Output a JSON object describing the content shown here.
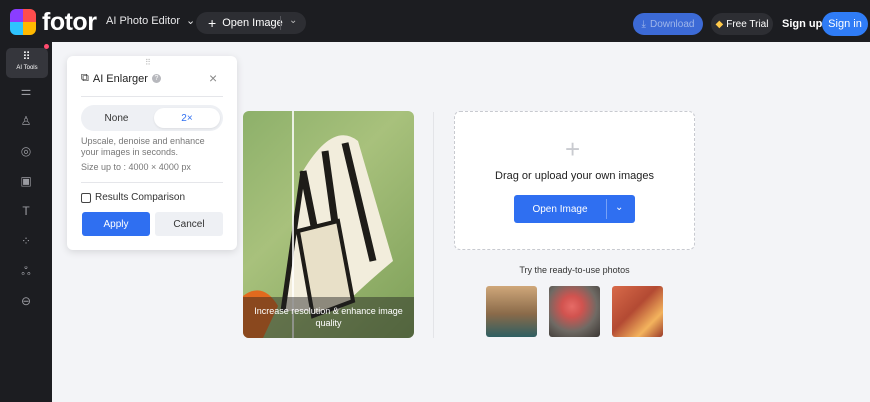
{
  "topbar": {
    "logo_text": "fotor",
    "editor_menu": "AI Photo Editor",
    "open_image": "Open Image",
    "download": "Download",
    "free_trial": "Free Trial",
    "sign_up": "Sign up",
    "sign_in": "Sign in"
  },
  "sidebar": {
    "ai_tools": "AI Tools",
    "icons": [
      "adjust-icon",
      "beauty-icon",
      "eye-icon",
      "frame-icon",
      "text-icon",
      "elements-icon",
      "effects-icon",
      "more-icon"
    ]
  },
  "panel": {
    "title": "AI Enlarger",
    "options": [
      "None",
      "2×"
    ],
    "selected": "2×",
    "description": "Upscale, denoise and enhance your images in seconds.",
    "size_limit": "Size up to : 4000 × 4000 px",
    "comparison_label": "Results Comparison",
    "apply": "Apply",
    "cancel": "Cancel"
  },
  "sample": {
    "caption": "Increase resolution & enhance image quality"
  },
  "upload": {
    "prompt": "Drag or upload your own images",
    "button": "Open Image",
    "try_label": "Try the ready-to-use photos"
  },
  "colors": {
    "accent": "#2f6ff1",
    "topbar_bg": "#1c1d21",
    "canvas_bg": "#f3f4f7"
  }
}
